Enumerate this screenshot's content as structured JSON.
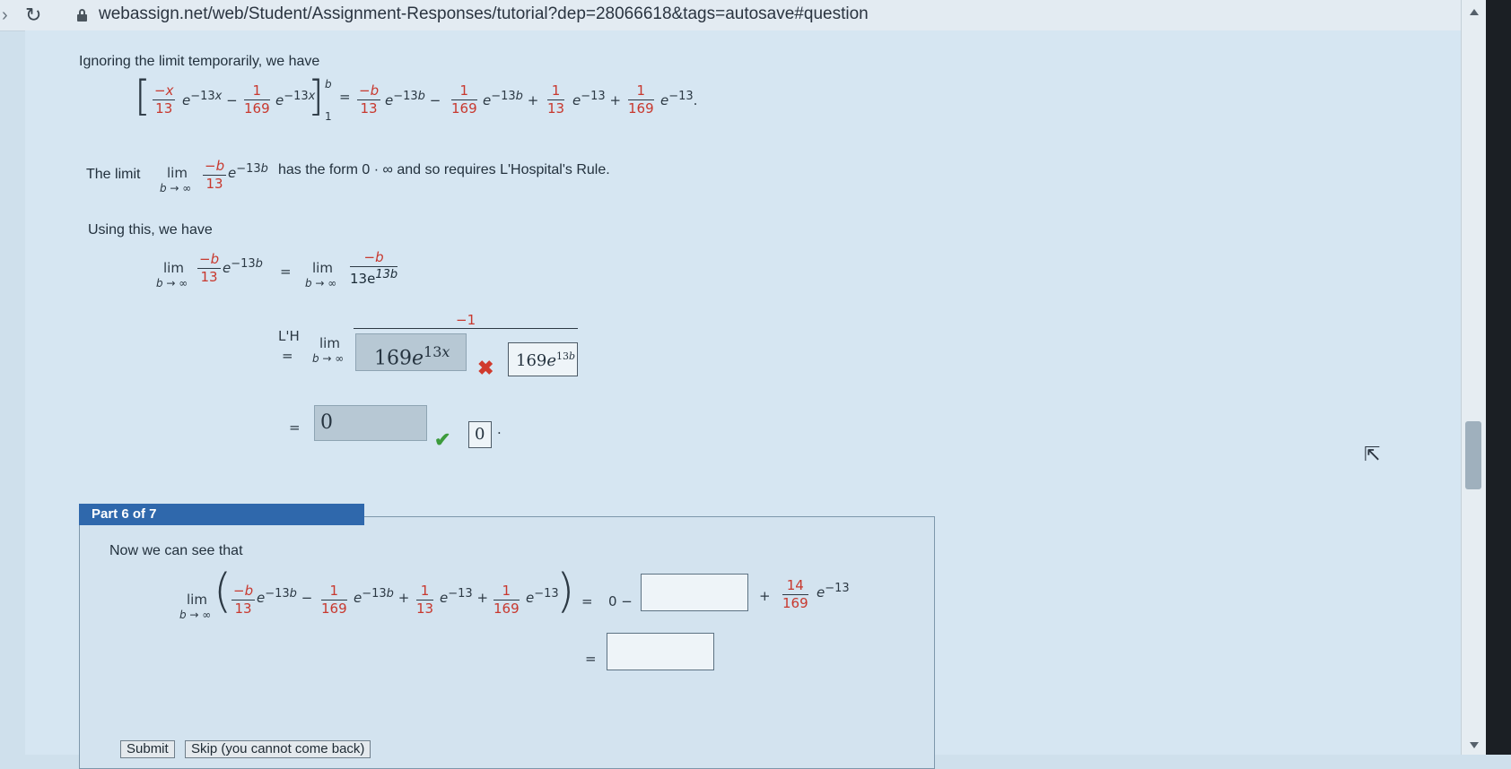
{
  "browser": {
    "url": "webassign.net/web/Student/Assignment-Responses/tutorial?dep=28066618&tags=autosave#question"
  },
  "part5": {
    "intro": "Ignoring the limit temporarily, we have",
    "limit_intro": "The limit",
    "limit_text": "has the form 0 · ∞ and so requires L'Hospital's Rule.",
    "using_text": "Using this, we have",
    "lhopital_label": "L'H",
    "answer1_entered": "169e13x",
    "answer1_correct": "169e13b",
    "answer1_status": "incorrect",
    "answer2_entered": "0",
    "answer2_correct": "0",
    "answer2_status": "correct"
  },
  "part6": {
    "tab_label": "Part 6 of 7",
    "intro": "Now we can see that",
    "prefix": "0 −",
    "coef_num": "14",
    "coef_den": "169",
    "input1_value": "",
    "input2_value": ""
  },
  "buttons": {
    "submit": "Submit",
    "skip": "Skip (you cannot come back)"
  },
  "colors": {
    "accent": "#2f68ac",
    "incorrect": "#d03a2d",
    "correct": "#3c9b3c",
    "fraction_red": "#c8382e"
  }
}
